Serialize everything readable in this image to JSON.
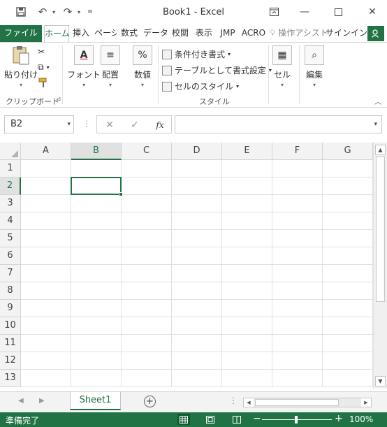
{
  "titlebar": {
    "title": "Book1 - Excel",
    "save_icon": "save-icon",
    "undo_icon": "undo-icon",
    "redo_icon": "redo-icon",
    "customize_icon": "customize-qat-icon",
    "ribbon_options_icon": "ribbon-display-icon",
    "minimize_icon": "minimize-icon",
    "maximize_icon": "maximize-icon",
    "close_icon": "close-icon"
  },
  "tabs": {
    "file": "ファイル",
    "home": "ホーム",
    "insert": "挿入",
    "page": "ページ",
    "formulas": "数式",
    "data": "データ",
    "review": "校閲",
    "view": "表示",
    "jmp": "JMP",
    "acrobat": "ACRO",
    "search": "操作アシスト",
    "signin": "サインイン"
  },
  "ribbon": {
    "paste": "貼り付け",
    "clipboard_group": "クリップボード",
    "font": "フォント",
    "alignment": "配置",
    "number": "数値",
    "cond_format": "条件付き書式",
    "format_table": "テーブルとして書式設定",
    "cell_styles": "セルのスタイル",
    "styles_group": "スタイル",
    "cells": "セル",
    "editing": "編集"
  },
  "formula_bar": {
    "name_box": "B2",
    "formula": "",
    "fx": "fx"
  },
  "grid": {
    "columns": [
      "A",
      "B",
      "C",
      "D",
      "E",
      "F",
      "G"
    ],
    "rows": [
      "1",
      "2",
      "3",
      "4",
      "5",
      "6",
      "7",
      "8",
      "9",
      "10",
      "11",
      "12",
      "13"
    ],
    "selected_cell": "B2"
  },
  "sheets": {
    "tabs": [
      "Sheet1"
    ],
    "active": "Sheet1"
  },
  "statusbar": {
    "status": "準備完了",
    "zoom": "100%"
  },
  "colors": {
    "accent": "#217346"
  }
}
